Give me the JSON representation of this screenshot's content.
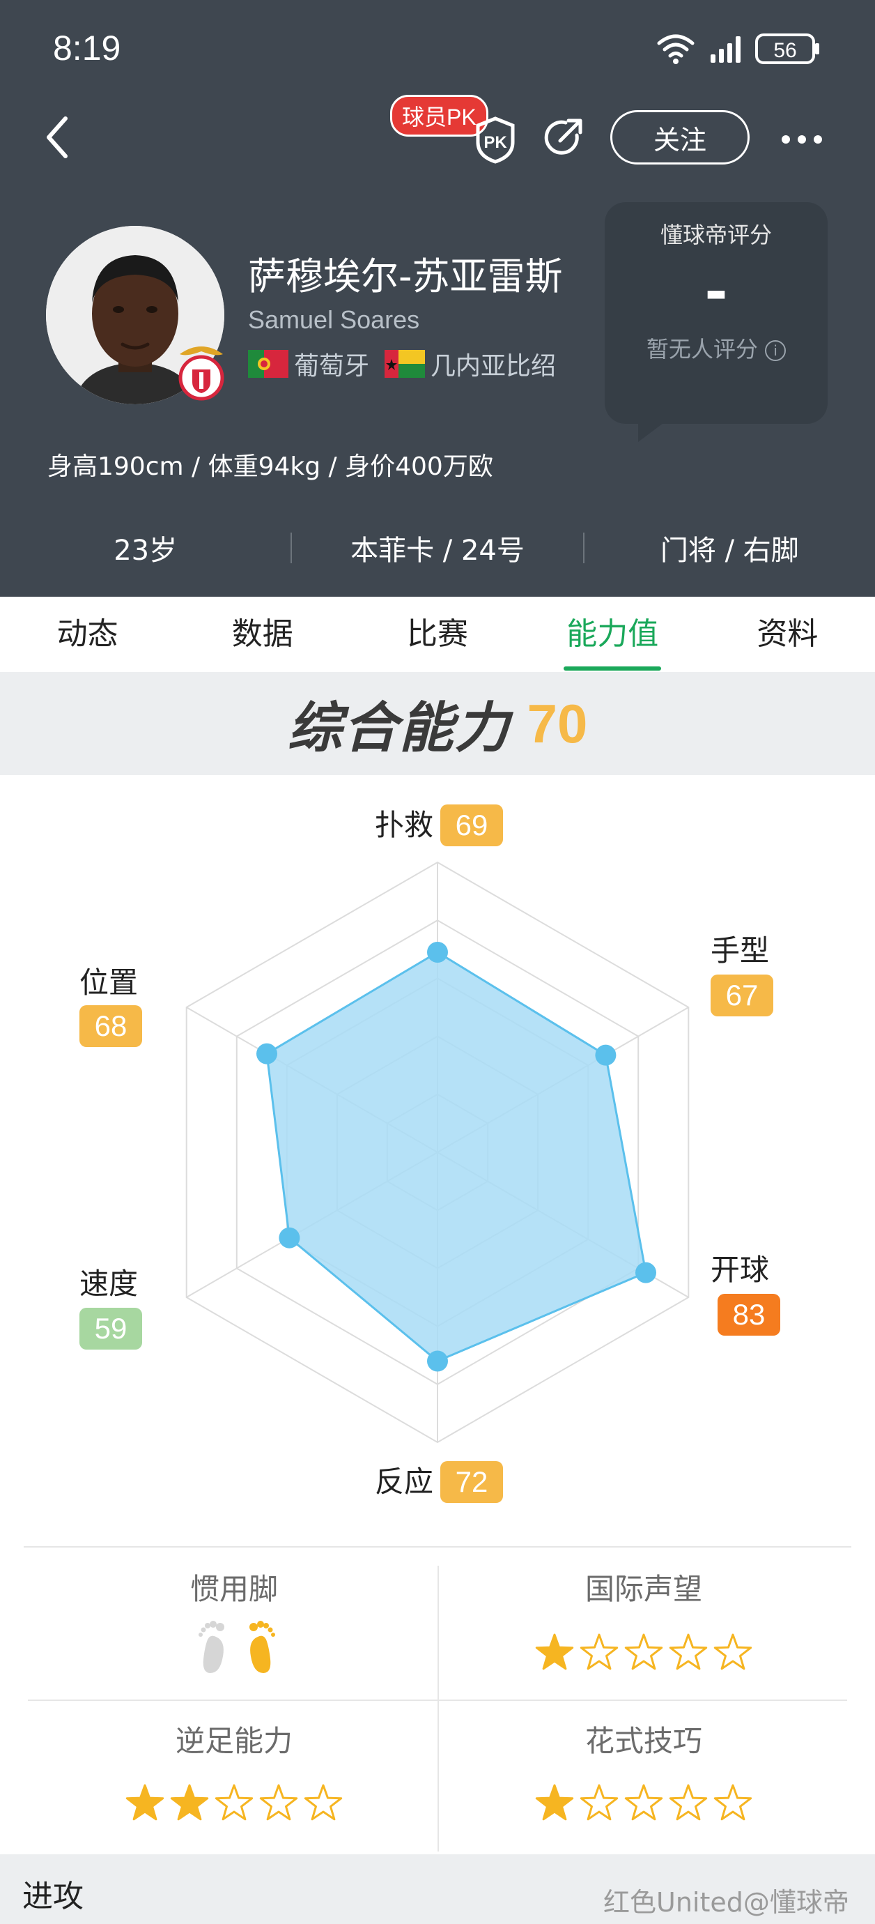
{
  "status_bar": {
    "time": "8:19",
    "battery": "56"
  },
  "header": {
    "pk_badge": "球员PK",
    "pk_shield_text": "PK",
    "follow_label": "关注",
    "player_name": "萨穆埃尔-苏亚雷斯",
    "english_name": "Samuel Soares",
    "nationalities": [
      "葡萄牙",
      "几内亚比绍"
    ],
    "rating": {
      "title": "懂球帝评分",
      "value": "-",
      "note": "暂无人评分"
    },
    "bio": "身高190cm / 体重94kg / 身价400万欧",
    "meta": [
      "23岁",
      "本菲卡 / 24号",
      "门将 / 右脚"
    ]
  },
  "tabs": [
    {
      "label": "动态",
      "active": false
    },
    {
      "label": "数据",
      "active": false
    },
    {
      "label": "比赛",
      "active": false
    },
    {
      "label": "能力值",
      "active": true
    },
    {
      "label": "资料",
      "active": false
    }
  ],
  "overall": {
    "label": "综合能力",
    "value": "70"
  },
  "chart_data": {
    "type": "radar",
    "axes": [
      "扑救",
      "手型",
      "开球",
      "反应",
      "速度",
      "位置"
    ],
    "values": [
      69,
      67,
      83,
      72,
      59,
      68
    ],
    "chip_colors": [
      "#f6b948",
      "#f6b948",
      "#f57c1f",
      "#f6b948",
      "#a7d7a0",
      "#f6b948"
    ],
    "range": [
      0,
      100
    ],
    "fill_color": "#a8dcf6",
    "stroke_color": "#5bc0ec"
  },
  "attributes": {
    "preferred_foot": {
      "title": "惯用脚",
      "left": "inactive",
      "right": "active"
    },
    "international_reputation": {
      "title": "国际声望",
      "stars": 1,
      "max": 5
    },
    "weak_foot": {
      "title": "逆足能力",
      "stars": 2,
      "max": 5
    },
    "skill_moves": {
      "title": "花式技巧",
      "stars": 1,
      "max": 5
    }
  },
  "bottom": {
    "section_label": "进攻",
    "watermark": "红色United@懂球帝"
  }
}
